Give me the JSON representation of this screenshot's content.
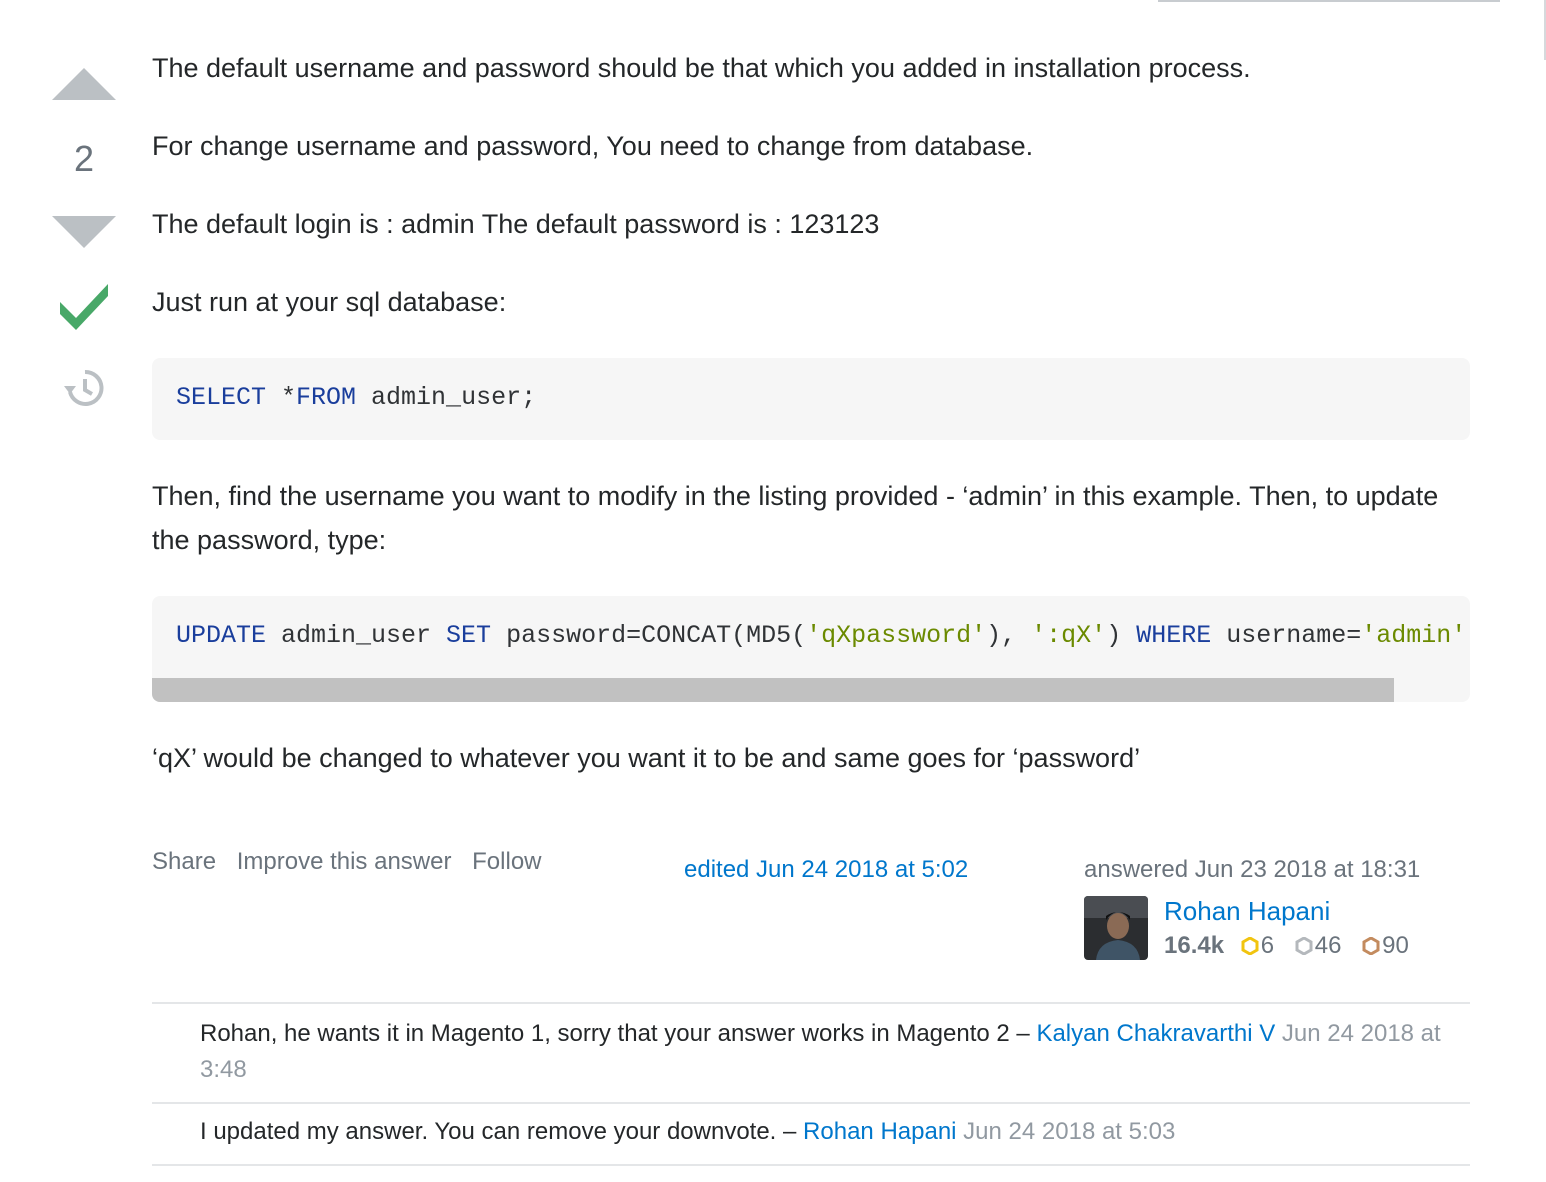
{
  "vote": {
    "count": "2"
  },
  "post": {
    "p1": "The default username and password should be that which you added in installation process.",
    "p2": "For change username and password, You need to change from database.",
    "p3": "The default login is : admin The default password is : 123123",
    "p4": "Just run at your sql database:",
    "code1": {
      "kw1": "SELECT",
      "rest1": " *",
      "kw2": "FROM",
      "rest2": " admin_user;"
    },
    "p5": "Then, find the username you want to modify in the listing provided - ‘admin’ in this example. Then, to update the password, type:",
    "code2": {
      "kw1": "UPDATE",
      "t1": " admin_user ",
      "kw2": "SET",
      "t2": " password=CONCAT(MD5(",
      "s1": "'qXpassword'",
      "t3": "), ",
      "s2": "':qX'",
      "t4": ") ",
      "kw3": "WHERE",
      "t5": " username=",
      "s3": "'admin';"
    },
    "p6": "‘qX’ would be changed to whatever you want it to be and same goes for ‘password’"
  },
  "menu": {
    "share": "Share",
    "improve": "Improve this answer",
    "follow": "Follow"
  },
  "edited": "edited Jun 24 2018 at 5:02",
  "answered": "answered Jun 23 2018 at 18:31",
  "user": {
    "name": "Rohan Hapani",
    "rep": "16.4k",
    "gold": "6",
    "silver": "46",
    "bronze": "90"
  },
  "colors": {
    "gold": "#f1c40f",
    "silver": "#b4b8bc",
    "bronze": "#c38b5f",
    "link": "#0077cc",
    "accepted": "#48a868"
  },
  "comments": [
    {
      "text": "Rohan, he wants it in Magento 1, sorry that your answer works in Magento 2 – ",
      "user": "Kalyan Chakravarthi V",
      "date": "Jun 24 2018 at 3:48"
    },
    {
      "text": "I updated my answer. You can remove your downvote. – ",
      "user": "Rohan Hapani",
      "date": "Jun 24 2018 at 5:03"
    }
  ]
}
